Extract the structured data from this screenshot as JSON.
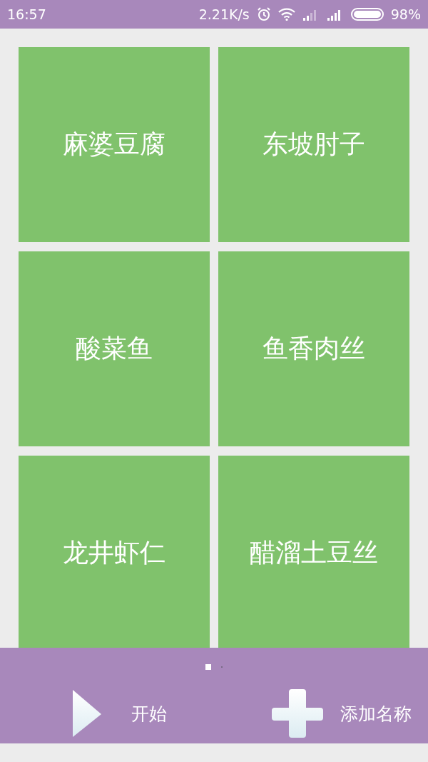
{
  "status_bar": {
    "time": "16:57",
    "speed": "2.21K/s",
    "battery": "98%"
  },
  "dishes": [
    {
      "name": "麻婆豆腐"
    },
    {
      "name": "东坡肘子"
    },
    {
      "name": "酸菜鱼"
    },
    {
      "name": "鱼香肉丝"
    },
    {
      "name": "龙井虾仁"
    },
    {
      "name": "醋溜土豆丝"
    }
  ],
  "page_dots": [
    {
      "selected": true
    },
    {
      "selected": false
    }
  ],
  "actions": [
    {
      "kind": "play",
      "label": "开始"
    },
    {
      "kind": "add",
      "label": "添加名称"
    }
  ]
}
